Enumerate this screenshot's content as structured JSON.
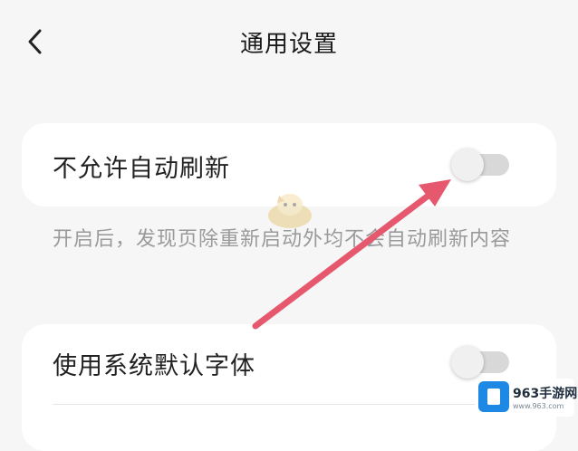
{
  "header": {
    "title": "通用设置",
    "back_icon": "chevron-left-icon"
  },
  "settings": [
    {
      "label": "不允许自动刷新",
      "toggle_on": false,
      "description": "开启后，发现页除重新启动外均不会自动刷新内容"
    },
    {
      "label": "使用系统默认字体",
      "toggle_on": false
    }
  ],
  "annotation": {
    "arrow_color": "#e5586e"
  },
  "watermark": {
    "brand": "963手游网",
    "url": "www.963.com"
  },
  "colors": {
    "background": "#f6f6f6",
    "card": "#ffffff",
    "text": "#222222",
    "description": "#9a9a9a",
    "toggle_track": "#d8d8d8",
    "toggle_knob": "#f0f0f0"
  }
}
